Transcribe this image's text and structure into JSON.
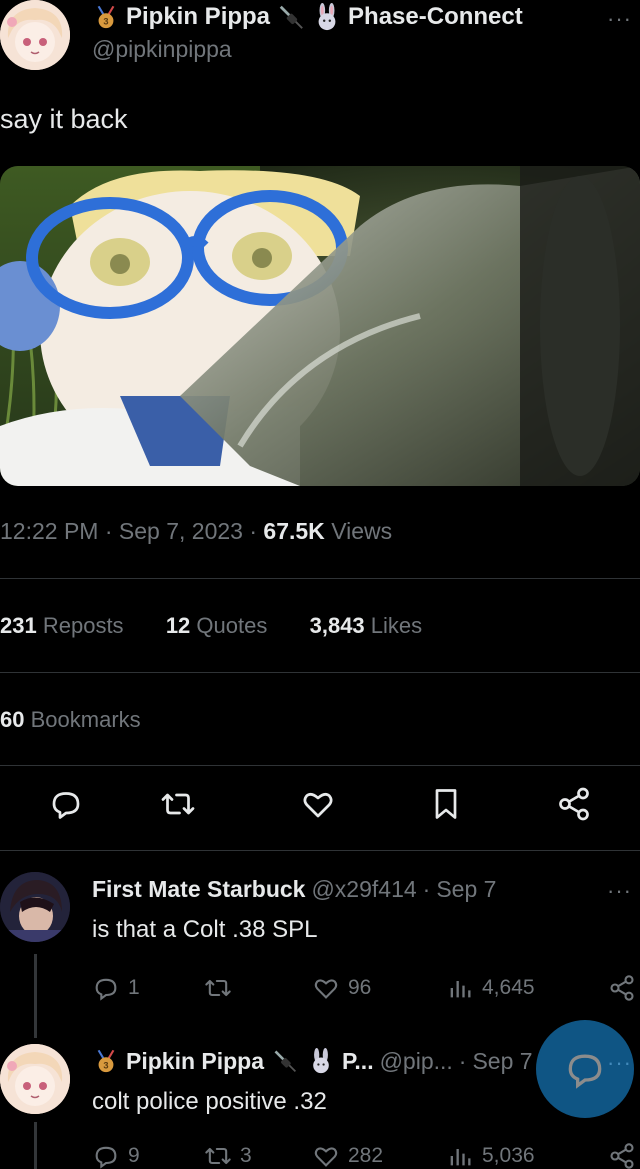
{
  "tweet": {
    "author_name": "Pipkin Pippa",
    "affiliation": "Phase-Connect",
    "handle": "@pipkinpippa",
    "badge_number": "3",
    "more_label": "···",
    "text": "say it back",
    "time": "12:22 PM",
    "date": "Sep 7, 2023",
    "views_count": "67.5K",
    "views_label": "Views",
    "sep": " · "
  },
  "stats": {
    "reposts_count": "231",
    "reposts_label": "Reposts",
    "quotes_count": "12",
    "quotes_label": "Quotes",
    "likes_count": "3,843",
    "likes_label": "Likes",
    "bookmarks_count": "60",
    "bookmarks_label": "Bookmarks"
  },
  "replies": [
    {
      "author_name": "First Mate Starbuck",
      "handle": "@x29f414",
      "date": "Sep 7",
      "text": "is that a Colt .38 SPL",
      "replies": "1",
      "reposts": "",
      "likes": "96",
      "views": "4,645"
    },
    {
      "author_name": "Pipkin Pippa",
      "affiliation_short": "P...",
      "handle": "@pip...",
      "date": "Sep 7",
      "text": "colt police positive .32",
      "replies": "9",
      "reposts": "3",
      "likes": "282",
      "views": "5,036"
    }
  ],
  "icons": [
    "reply-icon",
    "repost-icon",
    "like-icon",
    "bookmark-icon",
    "share-icon",
    "views-icon",
    "plug-icon",
    "bunny-icon",
    "medal-icon",
    "compose-reply-icon"
  ],
  "colors": {
    "background": "#000000",
    "text": "#e7e9ea",
    "muted": "#71767b",
    "divider": "#2f3336",
    "accent": "#1d9bf0"
  }
}
